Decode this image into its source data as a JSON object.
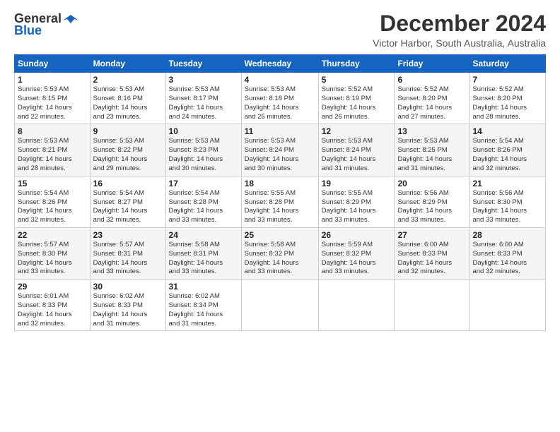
{
  "logo": {
    "line1": "General",
    "line2": "Blue",
    "icon": "▶"
  },
  "title": "December 2024",
  "location": "Victor Harbor, South Australia, Australia",
  "days_of_week": [
    "Sunday",
    "Monday",
    "Tuesday",
    "Wednesday",
    "Thursday",
    "Friday",
    "Saturday"
  ],
  "weeks": [
    [
      {
        "day": "1",
        "info": "Sunrise: 5:53 AM\nSunset: 8:15 PM\nDaylight: 14 hours\nand 22 minutes."
      },
      {
        "day": "2",
        "info": "Sunrise: 5:53 AM\nSunset: 8:16 PM\nDaylight: 14 hours\nand 23 minutes."
      },
      {
        "day": "3",
        "info": "Sunrise: 5:53 AM\nSunset: 8:17 PM\nDaylight: 14 hours\nand 24 minutes."
      },
      {
        "day": "4",
        "info": "Sunrise: 5:53 AM\nSunset: 8:18 PM\nDaylight: 14 hours\nand 25 minutes."
      },
      {
        "day": "5",
        "info": "Sunrise: 5:52 AM\nSunset: 8:19 PM\nDaylight: 14 hours\nand 26 minutes."
      },
      {
        "day": "6",
        "info": "Sunrise: 5:52 AM\nSunset: 8:20 PM\nDaylight: 14 hours\nand 27 minutes."
      },
      {
        "day": "7",
        "info": "Sunrise: 5:52 AM\nSunset: 8:20 PM\nDaylight: 14 hours\nand 28 minutes."
      }
    ],
    [
      {
        "day": "8",
        "info": "Sunrise: 5:53 AM\nSunset: 8:21 PM\nDaylight: 14 hours\nand 28 minutes."
      },
      {
        "day": "9",
        "info": "Sunrise: 5:53 AM\nSunset: 8:22 PM\nDaylight: 14 hours\nand 29 minutes."
      },
      {
        "day": "10",
        "info": "Sunrise: 5:53 AM\nSunset: 8:23 PM\nDaylight: 14 hours\nand 30 minutes."
      },
      {
        "day": "11",
        "info": "Sunrise: 5:53 AM\nSunset: 8:24 PM\nDaylight: 14 hours\nand 30 minutes."
      },
      {
        "day": "12",
        "info": "Sunrise: 5:53 AM\nSunset: 8:24 PM\nDaylight: 14 hours\nand 31 minutes."
      },
      {
        "day": "13",
        "info": "Sunrise: 5:53 AM\nSunset: 8:25 PM\nDaylight: 14 hours\nand 31 minutes."
      },
      {
        "day": "14",
        "info": "Sunrise: 5:54 AM\nSunset: 8:26 PM\nDaylight: 14 hours\nand 32 minutes."
      }
    ],
    [
      {
        "day": "15",
        "info": "Sunrise: 5:54 AM\nSunset: 8:26 PM\nDaylight: 14 hours\nand 32 minutes."
      },
      {
        "day": "16",
        "info": "Sunrise: 5:54 AM\nSunset: 8:27 PM\nDaylight: 14 hours\nand 32 minutes."
      },
      {
        "day": "17",
        "info": "Sunrise: 5:54 AM\nSunset: 8:28 PM\nDaylight: 14 hours\nand 33 minutes."
      },
      {
        "day": "18",
        "info": "Sunrise: 5:55 AM\nSunset: 8:28 PM\nDaylight: 14 hours\nand 33 minutes."
      },
      {
        "day": "19",
        "info": "Sunrise: 5:55 AM\nSunset: 8:29 PM\nDaylight: 14 hours\nand 33 minutes."
      },
      {
        "day": "20",
        "info": "Sunrise: 5:56 AM\nSunset: 8:29 PM\nDaylight: 14 hours\nand 33 minutes."
      },
      {
        "day": "21",
        "info": "Sunrise: 5:56 AM\nSunset: 8:30 PM\nDaylight: 14 hours\nand 33 minutes."
      }
    ],
    [
      {
        "day": "22",
        "info": "Sunrise: 5:57 AM\nSunset: 8:30 PM\nDaylight: 14 hours\nand 33 minutes."
      },
      {
        "day": "23",
        "info": "Sunrise: 5:57 AM\nSunset: 8:31 PM\nDaylight: 14 hours\nand 33 minutes."
      },
      {
        "day": "24",
        "info": "Sunrise: 5:58 AM\nSunset: 8:31 PM\nDaylight: 14 hours\nand 33 minutes."
      },
      {
        "day": "25",
        "info": "Sunrise: 5:58 AM\nSunset: 8:32 PM\nDaylight: 14 hours\nand 33 minutes."
      },
      {
        "day": "26",
        "info": "Sunrise: 5:59 AM\nSunset: 8:32 PM\nDaylight: 14 hours\nand 33 minutes."
      },
      {
        "day": "27",
        "info": "Sunrise: 6:00 AM\nSunset: 8:33 PM\nDaylight: 14 hours\nand 32 minutes."
      },
      {
        "day": "28",
        "info": "Sunrise: 6:00 AM\nSunset: 8:33 PM\nDaylight: 14 hours\nand 32 minutes."
      }
    ],
    [
      {
        "day": "29",
        "info": "Sunrise: 6:01 AM\nSunset: 8:33 PM\nDaylight: 14 hours\nand 32 minutes."
      },
      {
        "day": "30",
        "info": "Sunrise: 6:02 AM\nSunset: 8:33 PM\nDaylight: 14 hours\nand 31 minutes."
      },
      {
        "day": "31",
        "info": "Sunrise: 6:02 AM\nSunset: 8:34 PM\nDaylight: 14 hours\nand 31 minutes."
      },
      null,
      null,
      null,
      null
    ]
  ]
}
